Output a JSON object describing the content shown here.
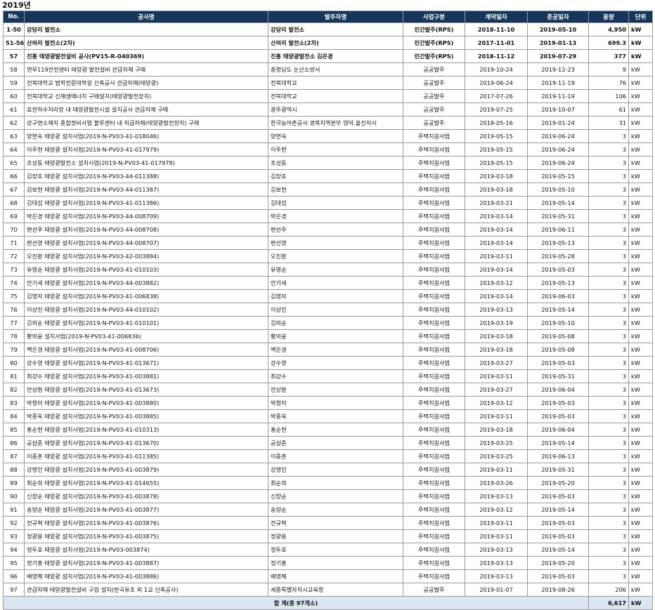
{
  "year_title": "2019년",
  "headers": [
    "No.",
    "공사명",
    "발주자명",
    "사업구분",
    "계약일자",
    "준공일자",
    "용량",
    "단위"
  ],
  "rows": [
    {
      "no": "1-50",
      "name": "강당리 발전소",
      "client": "강당리 발전소",
      "category": "민간발주(RPS)",
      "contract": "2018-11-10",
      "completion": "2019-05-10",
      "capacity": "4,950",
      "unit": "kW",
      "bold": true
    },
    {
      "no": "51-56",
      "name": "산의리 발전소(2차)",
      "client": "산의리 발전소(2차)",
      "category": "민간발주(RPS)",
      "contract": "2017-11-01",
      "completion": "2019-01-13",
      "capacity": "699.3",
      "unit": "kW",
      "bold": true
    },
    {
      "no": "57",
      "name": "진흥 태양광발전설비 공사(PV15-R-040369)",
      "client": "진흥 태양광발전소 김은경",
      "category": "민간발주(RPS)",
      "contract": "2018-11-12",
      "completion": "2019-07-29",
      "capacity": "377",
      "unit": "kW",
      "bold": true
    },
    {
      "no": "58",
      "name": "연무119안전센터 태양광 발전설비 관급자재 구매",
      "client": "충청남도 논산소방서",
      "category": "공공발주",
      "contract": "2019-10-24",
      "completion": "2019-12-23",
      "capacity": "9",
      "unit": "kW"
    },
    {
      "no": "59",
      "name": "전북대학교 법학전문대학원 신축공사 관급자재(태양광)",
      "client": "전북대학교",
      "category": "공공발주",
      "contract": "2019-06-24",
      "completion": "2019-11-19",
      "capacity": "76",
      "unit": "kW"
    },
    {
      "no": "60",
      "name": "전북대학교 신재생에너지 구매설치(태양광발전장치)",
      "client": "전북대학교",
      "category": "공공발주",
      "contract": "2017-07-26",
      "completion": "2019-11-19",
      "capacity": "106",
      "unit": "kW"
    },
    {
      "no": "61",
      "name": "효천하수처리장 내 태양광발전시설 설치공사 관급자재 구매",
      "client": "광주광역시",
      "category": "공공발주",
      "contract": "2019-07-25",
      "completion": "2019-10-07",
      "capacity": "61",
      "unit": "kW"
    },
    {
      "no": "62",
      "name": "강구면소재지 종합정비사업 블루센터 내 지급자재(태양광발전장치) 구매",
      "client": "한국농어촌공사 경북지역본부 영덕.울진지사",
      "category": "공공발주",
      "contract": "2018-05-16",
      "completion": "2019-01-24",
      "capacity": "31",
      "unit": "kW"
    },
    {
      "no": "63",
      "name": "양현숙 태양광 설치사업(2019-N-PV03-41-018046)",
      "client": "양현숙",
      "category": "주택지원사업",
      "contract": "2019-05-15",
      "completion": "2019-06-24",
      "capacity": "3",
      "unit": "kW"
    },
    {
      "no": "64",
      "name": "이주현 태양광 설치사업(2019-N-PV03-41-017979)",
      "client": "이주현",
      "category": "주택지원사업",
      "contract": "2019-05-15",
      "completion": "2019-06-24",
      "capacity": "3",
      "unit": "kW"
    },
    {
      "no": "65",
      "name": "조성동 태양광발전소 설치사업(2019-N-PV03-41-017978)",
      "client": "조성동",
      "category": "주택지원사업",
      "contract": "2019-05-15",
      "completion": "2019-06-24",
      "capacity": "3",
      "unit": "kW"
    },
    {
      "no": "66",
      "name": "김장호 태양광 설치사업(2019-N-PV03-44-011388)",
      "client": "김장호",
      "category": "주택지원사업",
      "contract": "2019-03-18",
      "completion": "2019-05-15",
      "capacity": "3",
      "unit": "kW"
    },
    {
      "no": "67",
      "name": "김보현 태양광 설치사업(2019-N-PV03-44-011387)",
      "client": "김보현",
      "category": "주택지원사업",
      "contract": "2019-03-18",
      "completion": "2019-05-10",
      "capacity": "3",
      "unit": "kW"
    },
    {
      "no": "68",
      "name": "김대섭 태양광 설치사업(2019-N-PV03-41-011386)",
      "client": "김대섭",
      "category": "주택지원사업",
      "contract": "2019-03-21",
      "completion": "2019-05-14",
      "capacity": "3",
      "unit": "kW"
    },
    {
      "no": "69",
      "name": "박은경 태양광 설치사업(2019-N-PV03-44-008709)",
      "client": "박은경",
      "category": "주택지원사업",
      "contract": "2019-03-14",
      "completion": "2019-05-31",
      "capacity": "3",
      "unit": "kW"
    },
    {
      "no": "70",
      "name": "편선주 태양광 설치사업(2019-N-PV03-44-008708)",
      "client": "편선주",
      "category": "주택지원사업",
      "contract": "2019-03-14",
      "completion": "2019-06-11",
      "capacity": "3",
      "unit": "kW"
    },
    {
      "no": "71",
      "name": "편선영 태양광 설치사업(2019-N-PV03-44-008707)",
      "client": "편선영",
      "category": "주택지원사업",
      "contract": "2019-03-14",
      "completion": "2019-05-13",
      "capacity": "3",
      "unit": "kW"
    },
    {
      "no": "72",
      "name": "오진환 태양광 설치사업(2019-N-PV03-42-003884)",
      "client": "오진환",
      "category": "주택지원사업",
      "contract": "2019-03-11",
      "completion": "2019-05-28",
      "capacity": "3",
      "unit": "kW"
    },
    {
      "no": "73",
      "name": "유영순 태양광 설치사업(2019-N-PV03-41-010103)",
      "client": "유영순",
      "category": "주택지원사업",
      "contract": "2019-03-14",
      "completion": "2019-05-03",
      "capacity": "3",
      "unit": "kW"
    },
    {
      "no": "74",
      "name": "안기세 태양광 설치사업(2019-N-PV03-44-003882)",
      "client": "안기세",
      "category": "주택지원사업",
      "contract": "2019-03-12",
      "completion": "2019-05-13",
      "capacity": "3",
      "unit": "kW"
    },
    {
      "no": "75",
      "name": "김영자 태양광 설치사업(2019-N-PV03-41-006838)",
      "client": "김영자",
      "category": "주택지원사업",
      "contract": "2019-03-14",
      "completion": "2019-06-03",
      "capacity": "3",
      "unit": "kW"
    },
    {
      "no": "76",
      "name": "이상진 태양광 설치사업(2019-N-PV03-44-010102)",
      "client": "이상진",
      "category": "주택지원사업",
      "contract": "2019-03-13",
      "completion": "2019-05-14",
      "capacity": "3",
      "unit": "kW"
    },
    {
      "no": "77",
      "name": "김의순 태양광 설치사업(2019-N-PV03-41-010101)",
      "client": "김의순",
      "category": "주택지원사업",
      "contract": "2019-03-19",
      "completion": "2019-05-10",
      "capacity": "3",
      "unit": "kW"
    },
    {
      "no": "78",
      "name": "황의윤 설치사업(2019-N-PV03-41-006836)",
      "client": "황의윤",
      "category": "주택지원사업",
      "contract": "2019-03-18",
      "completion": "2019-05-08",
      "capacity": "3",
      "unit": "kW"
    },
    {
      "no": "79",
      "name": "백은경 태양광 설치사업(2019-N-PV03-41-008706)",
      "client": "백은경",
      "category": "주택지원사업",
      "contract": "2019-03-18",
      "completion": "2019-05-08",
      "capacity": "3",
      "unit": "kW"
    },
    {
      "no": "80",
      "name": "강수영 태양광 설치사업(2019-N-PV03-41-013671)",
      "client": "강수영",
      "category": "주택지원사업",
      "contract": "2019-03-27",
      "completion": "2019-05-03",
      "capacity": "3",
      "unit": "kW"
    },
    {
      "no": "81",
      "name": "최강수 태양광 설치사업(2019-N-PV03-41-003881)",
      "client": "최강수",
      "category": "주택지원사업",
      "contract": "2019-03-11",
      "completion": "2019-05-31",
      "capacity": "3",
      "unit": "kW"
    },
    {
      "no": "82",
      "name": "안상환 태양광 설치사업(2019-N-PV03-41-013673)",
      "client": "안상환",
      "category": "주택지원사업",
      "contract": "2019-03-27",
      "completion": "2019-06-04",
      "capacity": "3",
      "unit": "kW"
    },
    {
      "no": "83",
      "name": "박청미 태양광 설치사업(2019-N-PV03-41-003880)",
      "client": "박청미",
      "category": "주택지원사업",
      "contract": "2019-03-12",
      "completion": "2019-05-03",
      "capacity": "3",
      "unit": "kW"
    },
    {
      "no": "84",
      "name": "박종욱 태양광 설치사업(2019-N-PV03-41-003885)",
      "client": "박종욱",
      "category": "주택지원사업",
      "contract": "2019-03-11",
      "completion": "2019-05-03",
      "capacity": "3",
      "unit": "kW"
    },
    {
      "no": "85",
      "name": "홍순현 태양광 설치사업(2019-N-PV03-41-010313)",
      "client": "홍순현",
      "category": "주택지원사업",
      "contract": "2019-03-18",
      "completion": "2019-06-04",
      "capacity": "3",
      "unit": "kW"
    },
    {
      "no": "86",
      "name": "공삼준 태양광 설치사업(2019-N-PV03-41-013670)",
      "client": "공삼준",
      "category": "주택지원사업",
      "contract": "2019-03-25",
      "completion": "2019-05-14",
      "capacity": "3",
      "unit": "kW"
    },
    {
      "no": "87",
      "name": "이중훈 태양광 설치사업(2019-N-PV03-41-011385)",
      "client": "이중훈",
      "category": "주택지원사업",
      "contract": "2019-03-25",
      "completion": "2019-06-13",
      "capacity": "3",
      "unit": "kW"
    },
    {
      "no": "88",
      "name": "강명인 태양광 설치사업(2019-N-PV03-41-003879)",
      "client": "강명인",
      "category": "주택지원사업",
      "contract": "2019-03-11",
      "completion": "2019-05-31",
      "capacity": "3",
      "unit": "kW"
    },
    {
      "no": "89",
      "name": "최순희 태양광 설치사업(2019-N-PV03-41-014655)",
      "client": "최순희",
      "category": "주택지원사업",
      "contract": "2019-03-26",
      "completion": "2019-05-20",
      "capacity": "3",
      "unit": "kW"
    },
    {
      "no": "90",
      "name": "신창순 태양광 설치사업(2019-N-PV03-41-003878)",
      "client": "신창순",
      "category": "주택지원사업",
      "contract": "2019-03-13",
      "completion": "2019-05-03",
      "capacity": "3",
      "unit": "kW"
    },
    {
      "no": "91",
      "name": "송양순 태양광 설치사업(2019-N-PV03-41-003877)",
      "client": "송양순",
      "category": "주택지원사업",
      "contract": "2019-03-12",
      "completion": "2019-05-14",
      "capacity": "3",
      "unit": "kW"
    },
    {
      "no": "92",
      "name": "전규혁 태양광 설치사업(2019-N-PV03-41-003876)",
      "client": "전규혁",
      "category": "주택지원사업",
      "contract": "2019-03-11",
      "completion": "2019-05-03",
      "capacity": "3",
      "unit": "kW"
    },
    {
      "no": "93",
      "name": "정광용 태양광 설치사업(2019-N-PV03-41-003875)",
      "client": "정광용",
      "category": "주택지원사업",
      "contract": "2019-03-11",
      "completion": "2019-05-03",
      "capacity": "3",
      "unit": "kW"
    },
    {
      "no": "94",
      "name": "정두호 태양광 설치사업(2019-N-PV03-003874)",
      "client": "정두호",
      "category": "주택지원사업",
      "contract": "2019-03-13",
      "completion": "2019-05-14",
      "capacity": "3",
      "unit": "kW"
    },
    {
      "no": "95",
      "name": "정기홍 태양광 설치사업(2019-N-PV03-41-003887)",
      "client": "정기홍",
      "category": "주택지원사업",
      "contract": "2019-03-13",
      "completion": "2019-05-20",
      "capacity": "3",
      "unit": "kW"
    },
    {
      "no": "96",
      "name": "배영해 태양광 설치사업(2019-N-PV03-41-003886)",
      "client": "배영해",
      "category": "주택지원사업",
      "contract": "2019-03-13",
      "completion": "2019-05-03",
      "capacity": "3",
      "unit": "kW"
    },
    {
      "no": "97",
      "name": "관급자재 태양광발전설비 구입 설치(반곡유초 외 1교 신축공사)",
      "client": "세종특별자치시교육청",
      "category": "공공발주",
      "contract": "2019-01-07",
      "completion": "2019-08-26",
      "capacity": "206",
      "unit": "kW"
    }
  ],
  "total": {
    "label": "합 계(총 97개소)",
    "capacity": "6,617",
    "unit": "kW"
  }
}
